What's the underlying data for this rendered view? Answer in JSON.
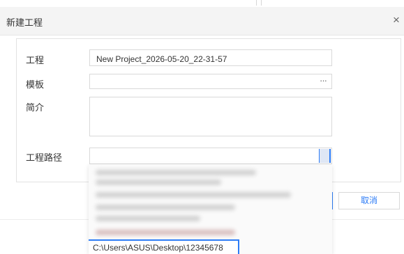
{
  "dialog": {
    "title": "新建工程",
    "close_symbol": "×"
  },
  "form": {
    "project": {
      "label": "工程",
      "value": "New Project_2026-05-20_22-31-57"
    },
    "template": {
      "label": "模板",
      "value": "",
      "browse_symbol": "···"
    },
    "intro": {
      "label": "简介",
      "value": ""
    },
    "path": {
      "label": "工程路径",
      "selected_value": ""
    }
  },
  "dropdown": {
    "visible_item": "C:\\Users\\ASUS\\Desktop\\12345678"
  },
  "buttons": {
    "cancel_label": "取消"
  },
  "colors": {
    "accent": "#2d7cf6",
    "title_bar": "#f4f4f4",
    "border": "#d9d9d9"
  }
}
